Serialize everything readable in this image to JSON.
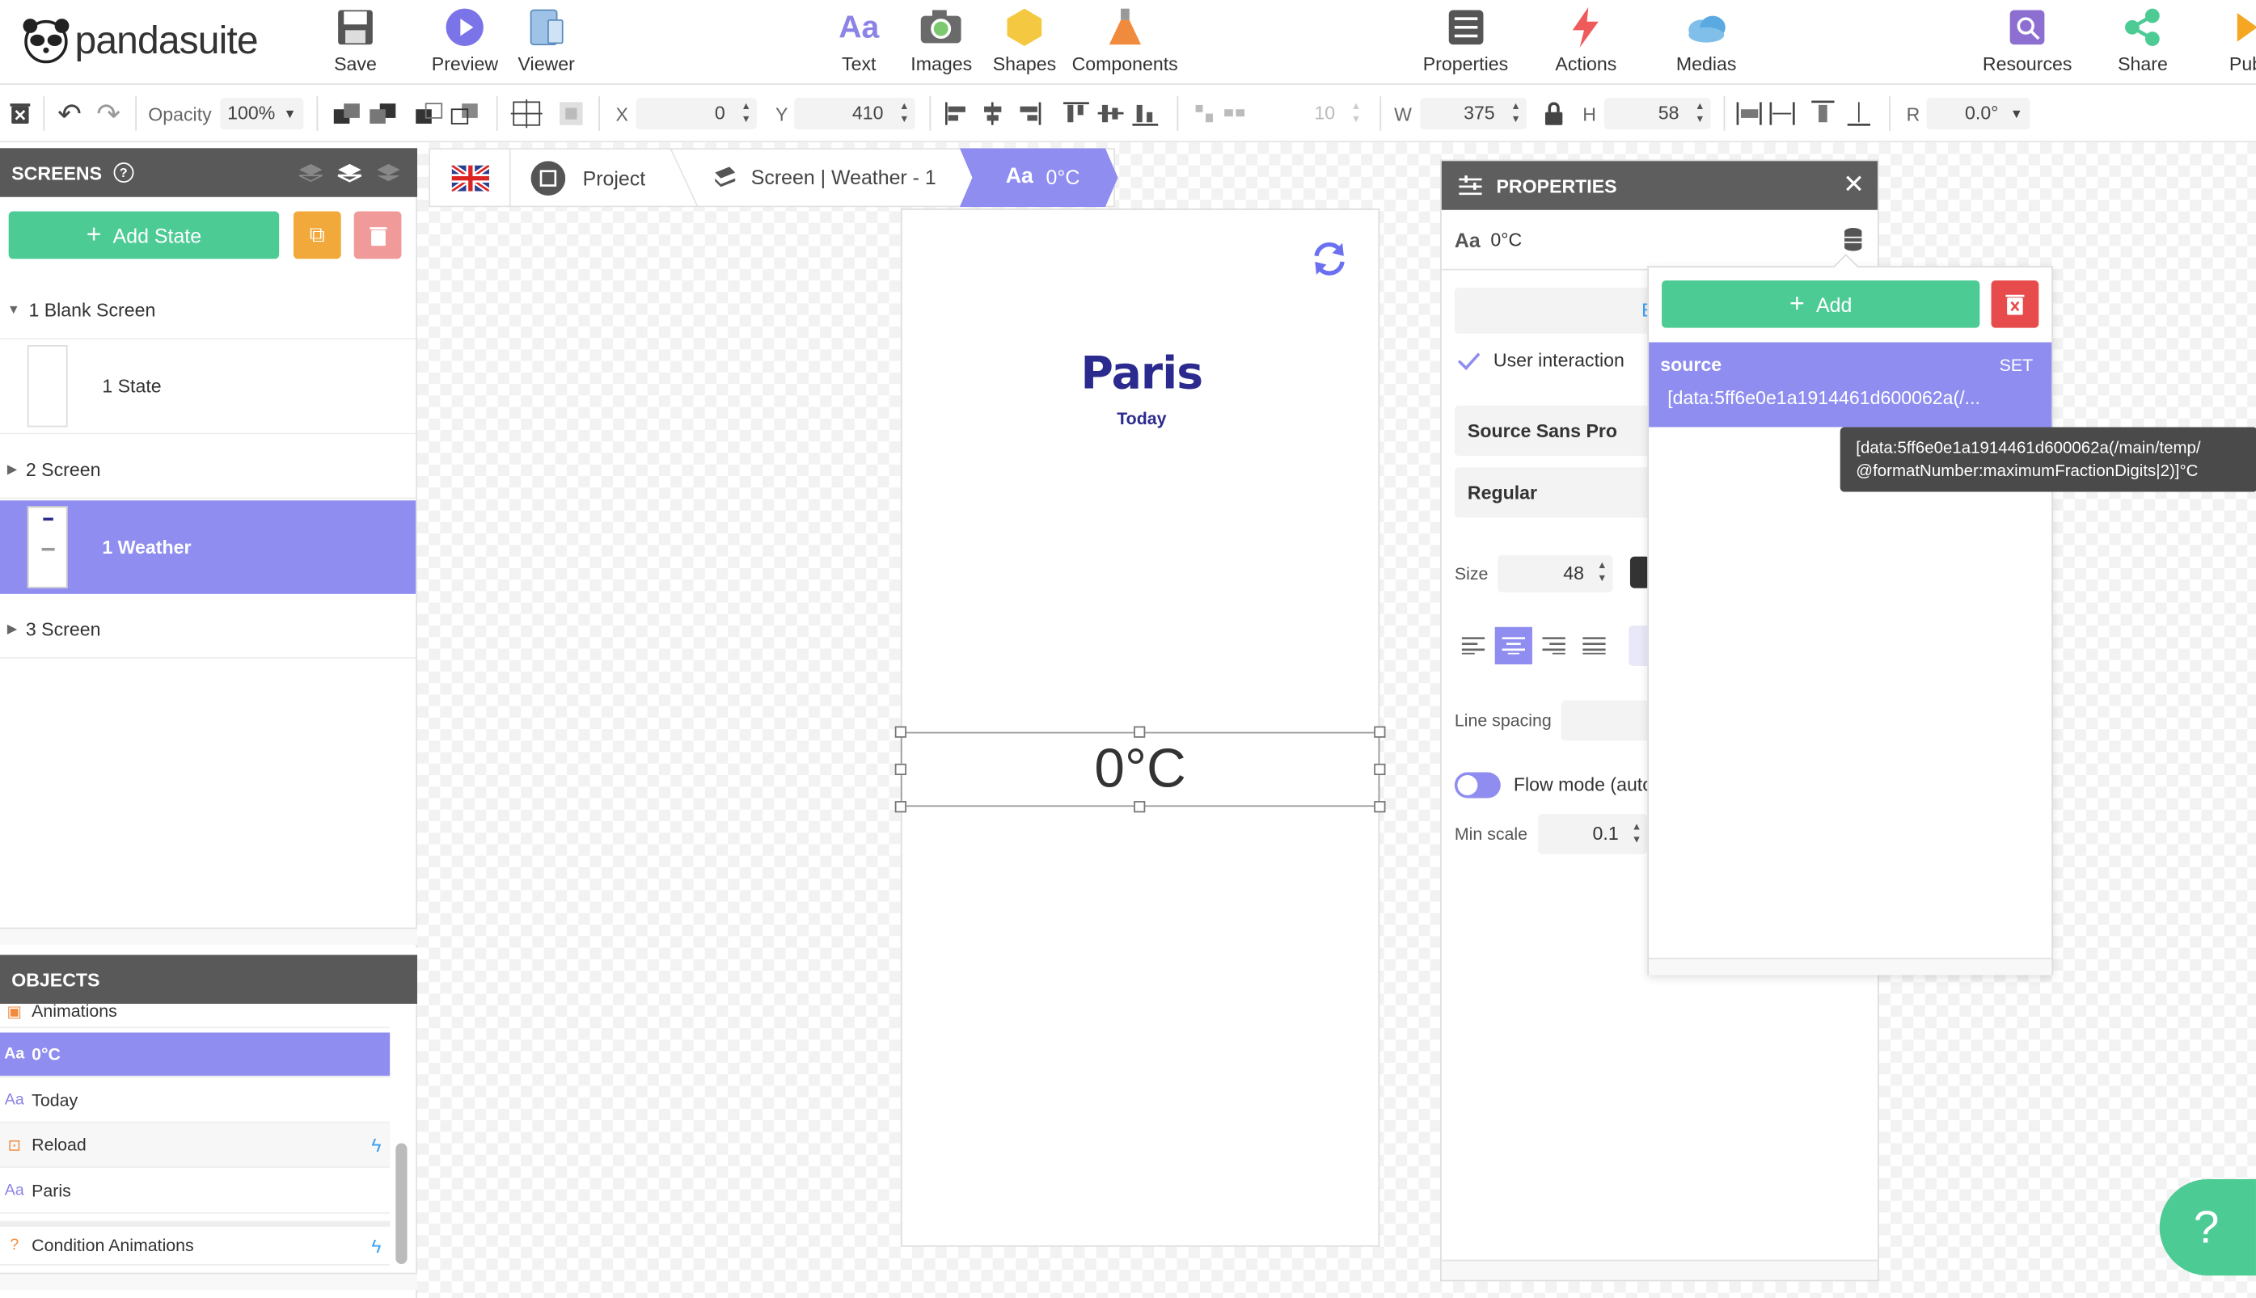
{
  "app": {
    "logo_text": "pandasuite"
  },
  "toolbar": {
    "save": "Save",
    "preview": "Preview",
    "viewer": "Viewer",
    "text": "Text",
    "images": "Images",
    "shapes": "Shapes",
    "components": "Components",
    "properties": "Properties",
    "actions": "Actions",
    "medias": "Medias",
    "resources": "Resources",
    "share": "Share",
    "publish": "Pub"
  },
  "ribbon": {
    "opacity_label": "Opacity",
    "opacity_value": "100%",
    "x_label": "X",
    "x_value": "0",
    "y_label": "Y",
    "y_value": "410",
    "spacing_value": "10",
    "w_label": "W",
    "w_value": "375",
    "h_label": "H",
    "h_value": "58",
    "r_label": "R",
    "r_value": "0.0°"
  },
  "screens_panel": {
    "title": "SCREENS",
    "add_state": "Add State",
    "items": [
      {
        "label": "1 Blank Screen",
        "expanded": true
      },
      {
        "label": "1 State"
      },
      {
        "label": "2 Screen",
        "expanded": false
      },
      {
        "label": "1 Weather",
        "selected": true
      },
      {
        "label": "3 Screen",
        "expanded": false
      }
    ]
  },
  "objects_panel": {
    "title": "OBJECTS",
    "items": [
      {
        "label": "Animations",
        "icon": "animations-icon"
      },
      {
        "label": "0°C",
        "icon": "text-icon",
        "selected": true
      },
      {
        "label": "Today",
        "icon": "text-icon"
      },
      {
        "label": "Reload",
        "icon": "reload-object-icon",
        "has_action": true
      },
      {
        "label": "Paris",
        "icon": "text-icon"
      },
      {
        "label": "Condition Animations",
        "icon": "condition-icon",
        "has_action": true
      }
    ]
  },
  "breadcrumb": {
    "project": "Project",
    "screen": "Screen | Weather - 1",
    "current": "0°C",
    "current_prefix": "Aa"
  },
  "canvas": {
    "city": "Paris",
    "day": "Today",
    "temperature": "0°C"
  },
  "properties_panel": {
    "title": "PROPERTIES",
    "object_prefix": "Aa",
    "object_name": "0°C",
    "user_interaction": "User interaction",
    "font_family": "Source Sans Pro",
    "font_weight": "Regular",
    "size_label": "Size",
    "size_value": "48",
    "line_spacing_label": "Line spacing",
    "flow_mode_label": "Flow mode (auto",
    "min_scale_label": "Min scale",
    "min_scale_value": "0.1",
    "partial_button_letter": "E"
  },
  "data_popup": {
    "add_label": "Add",
    "binding_name": "source",
    "binding_state": "SET",
    "binding_value": "[data:5ff6e0e1a1914461d600062a(/...",
    "tooltip_line1": "[data:5ff6e0e1a1914461d600062a(/main/temp/",
    "tooltip_line2": "@formatNumber:maximumFractionDigits|2)]°C"
  },
  "help": {
    "label": "?"
  },
  "colors": {
    "accent": "#8f8ef0",
    "green": "#4dcb95",
    "red": "#e84b4b",
    "orange": "#f2a93b",
    "panel_dark": "#595959",
    "city_blue": "#2b2a8f"
  }
}
